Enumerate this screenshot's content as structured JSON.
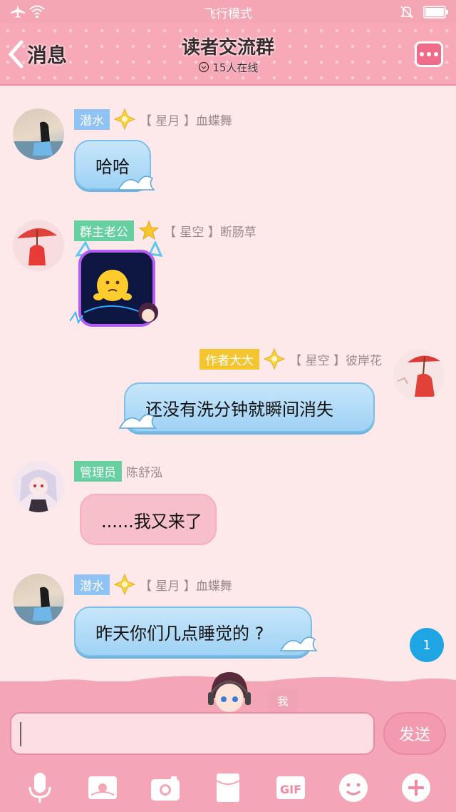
{
  "status_bar": {
    "mode": "飞行模式"
  },
  "header": {
    "back_label": "消息",
    "title": "读者交流群",
    "online": "15人在线"
  },
  "messages": [
    {
      "tag": "潜水",
      "rank": "【 星月 】",
      "name": "血蝶舞",
      "text": "哈哈"
    },
    {
      "tag": "群主老公",
      "rank": "【 星空 】",
      "name": "断肠草",
      "text": ""
    },
    {
      "tag": "作者大大",
      "rank": "【 星空 】",
      "name": "彼岸花",
      "text": "还没有洗分钟就瞬间消失"
    },
    {
      "tag": "管理员",
      "rank": "",
      "name": "陈舒泓",
      "text": "......我又来了"
    },
    {
      "tag": "潜水",
      "rank": "【 星月 】",
      "name": "血蝶舞",
      "text": "昨天你们几点睡觉的 ?"
    }
  ],
  "unread_count": "1",
  "composer": {
    "me_label": "我",
    "send_label": "发送",
    "gif_label": "GIF"
  },
  "colors": {
    "header": "#f7a9b8",
    "background": "#fde8ea",
    "bubble_blue": "#c7e6fb",
    "bubble_pink": "#f7bfca",
    "badge": "#1fa5e3"
  }
}
